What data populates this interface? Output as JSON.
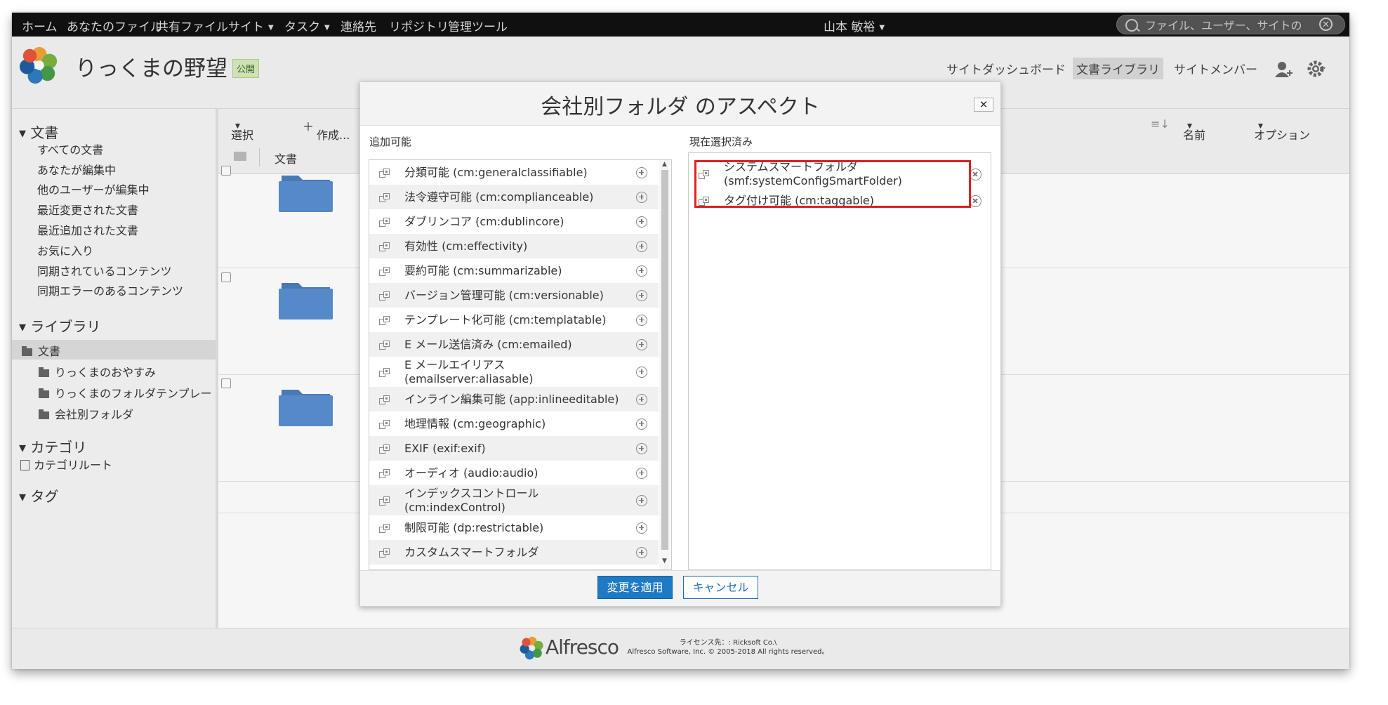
{
  "topnav": {
    "items": [
      {
        "label": "ホーム"
      },
      {
        "label": "あなたのファイル"
      },
      {
        "label": "共有ファイル"
      },
      {
        "label": "サイト",
        "caret": true
      },
      {
        "label": "タスク",
        "caret": true
      },
      {
        "label": "連絡先"
      },
      {
        "label": "リポジトリ"
      },
      {
        "label": "管理ツール"
      }
    ],
    "user": "山本 敏裕",
    "search_placeholder": "ファイル、ユーザー、サイトの"
  },
  "site": {
    "title": "りっくまの野望",
    "badge": "公開",
    "nav": [
      "サイトダッシュボード",
      "文書ライブラリ",
      "サイトメンバー"
    ]
  },
  "sidebar": {
    "documents_header": "▾ 文書",
    "documents": [
      "すべての文書",
      "あなたが編集中",
      "他のユーザーが編集中",
      "最近変更された文書",
      "最近追加された文書",
      "お気に入り",
      "同期されているコンテンツ",
      "同期エラーのあるコンテンツ"
    ],
    "library_header": "▾ ライブラリ",
    "library_root": "文書",
    "library_folders": [
      "りっくまのおやすみ",
      "りっくまのフォルダテンプレー",
      "会社別フォルダ"
    ],
    "category_header": "▾ カテゴリ",
    "category_root": "カテゴリルート",
    "tag_header": "▾ タグ"
  },
  "toolbar": {
    "select": "選択",
    "create": "作成...",
    "sort_by": "名前",
    "options": "オプション"
  },
  "listing": {
    "header_label": "文書"
  },
  "dialog": {
    "title": "会社別フォルダ のアスペクト",
    "close": "✕",
    "available_label": "追加可能",
    "selected_label": "現在選択済み",
    "available": [
      {
        "line1": "分類可能 (cm:generalclassifiable)"
      },
      {
        "line1": "法令遵守可能 (cm:complianceable)"
      },
      {
        "line1": "ダブリンコア (cm:dublincore)"
      },
      {
        "line1": "有効性 (cm:effectivity)"
      },
      {
        "line1": "要約可能 (cm:summarizable)"
      },
      {
        "line1": "バージョン管理可能 (cm:versionable)"
      },
      {
        "line1": "テンプレート化可能 (cm:templatable)"
      },
      {
        "line1": "E メール送信済み (cm:emailed)"
      },
      {
        "line1": "E メールエイリアス",
        "line2": "(emailserver:aliasable)"
      },
      {
        "line1": "インライン編集可能 (app:inlineeditable)"
      },
      {
        "line1": "地理情報 (cm:geographic)"
      },
      {
        "line1": "EXIF (exif:exif)"
      },
      {
        "line1": "オーディオ (audio:audio)"
      },
      {
        "line1": "インデックスコントロール",
        "line2": "(cm:indexControl)"
      },
      {
        "line1": "制限可能 (dp:restrictable)"
      },
      {
        "line1": "カスタムスマートフォルダ"
      }
    ],
    "selected": [
      {
        "line1": "システムスマートフォルダ",
        "line2": "(smf:systemConfigSmartFolder)"
      },
      {
        "line1": "タグ付け可能 (cm:taggable)"
      }
    ],
    "apply": "変更を適用",
    "cancel": "キャンセル"
  },
  "footer": {
    "brand": "Alfresco",
    "license_line1": "ライセンス先：: Ricksoft Co.\\",
    "license_line2": "Alfresco Software, Inc. © 2005-2018 All rights reserved。"
  },
  "colors": {
    "accent": "#1f7ac4",
    "highlight": "#e02020",
    "folder": "#5a8fd0"
  }
}
